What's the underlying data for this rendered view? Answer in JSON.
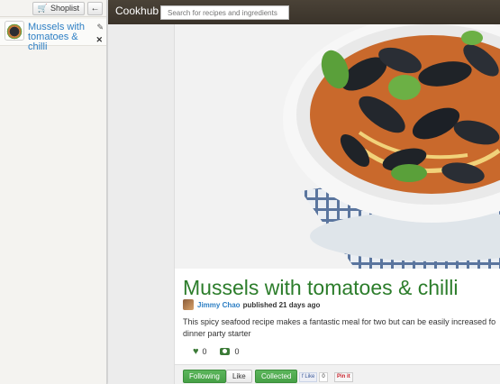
{
  "sidebar": {
    "shoplist_label": "Shoplist",
    "items": [
      {
        "title": "Mussels with tomatoes & chilli"
      }
    ]
  },
  "topbar": {
    "brand": "Cookhub",
    "search_placeholder": "Search for recipes and ingredients"
  },
  "recipe": {
    "title": "Mussels with tomatoes & chilli",
    "author": "Jimmy Chao",
    "published": "published 21 days ago",
    "description": "This spicy seafood recipe makes a fantastic meal for two but can be easily increased fo dinner party starter",
    "likes": "0",
    "photos": "0"
  },
  "actions": {
    "following": "Following",
    "like": "Like",
    "collected": "Collected",
    "fb_like": "Like",
    "fb_count": "0",
    "pinit": "Pin it"
  },
  "colors": {
    "brand_bar": "#3e372d",
    "accent_green": "#4caf50",
    "title_green": "#2c7d2b",
    "link_blue": "#2d7fc4"
  }
}
